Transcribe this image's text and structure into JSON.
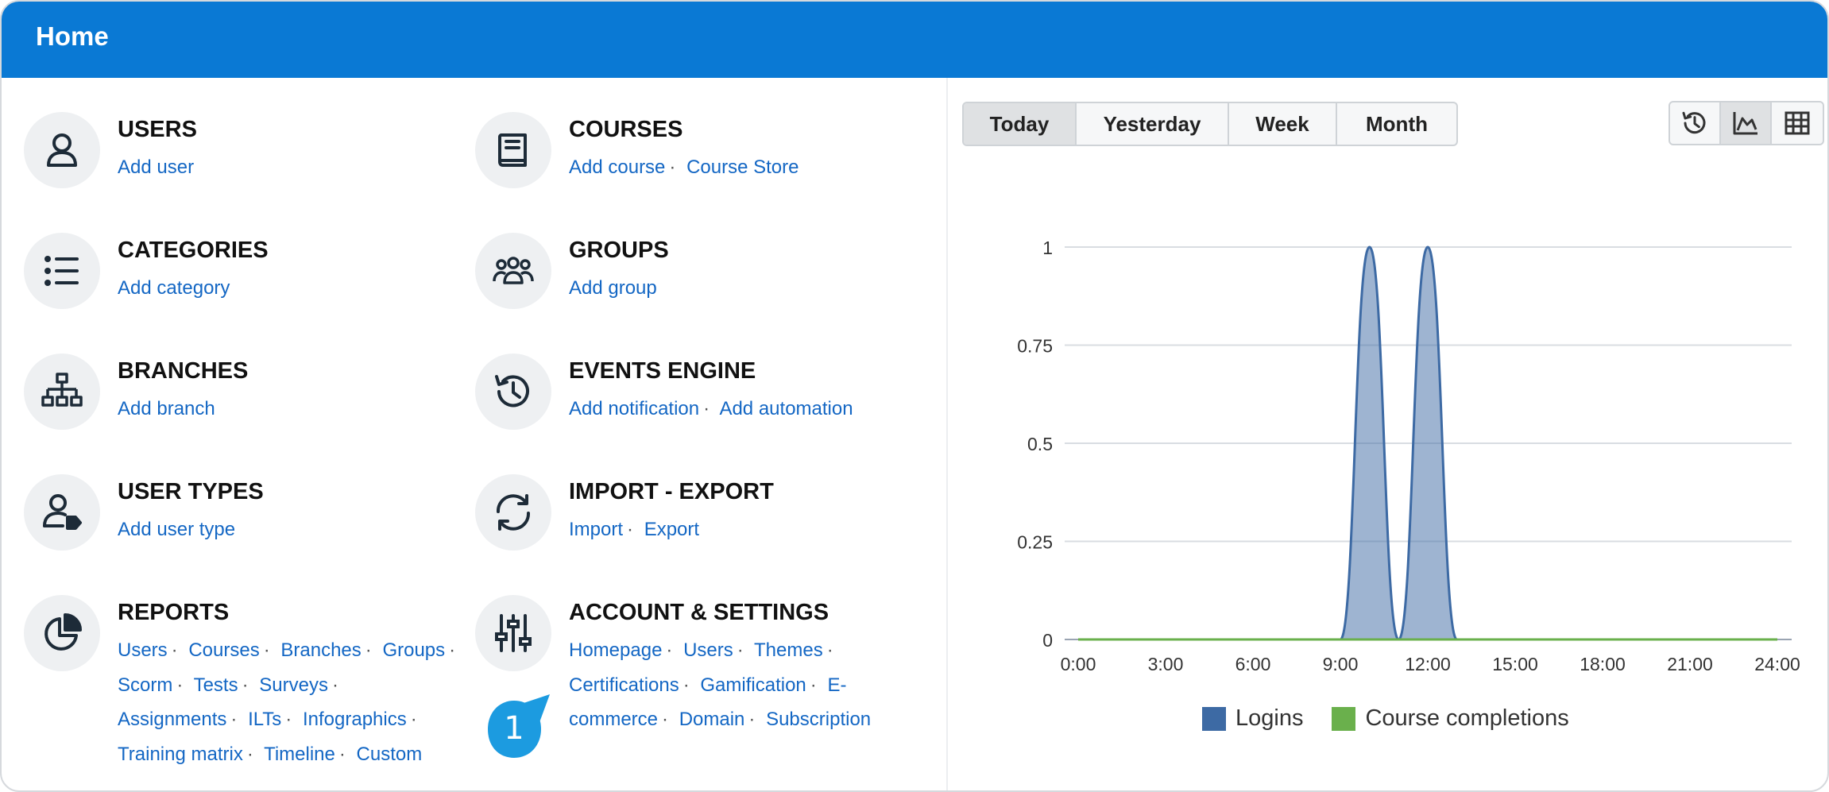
{
  "header": {
    "title": "Home"
  },
  "tiles": [
    {
      "title": "USERS",
      "icon": "user-icon",
      "links": [
        "Add user"
      ]
    },
    {
      "title": "COURSES",
      "icon": "book-icon",
      "links": [
        "Add course",
        "Course Store"
      ]
    },
    {
      "title": "CATEGORIES",
      "icon": "list-icon",
      "links": [
        "Add category"
      ]
    },
    {
      "title": "GROUPS",
      "icon": "group-icon",
      "links": [
        "Add group"
      ]
    },
    {
      "title": "BRANCHES",
      "icon": "sitemap-icon",
      "links": [
        "Add branch"
      ]
    },
    {
      "title": "EVENTS ENGINE",
      "icon": "history-icon",
      "links": [
        "Add notification",
        "Add automation"
      ]
    },
    {
      "title": "USER TYPES",
      "icon": "user-tag-icon",
      "links": [
        "Add user type"
      ]
    },
    {
      "title": "IMPORT - EXPORT",
      "icon": "sync-icon",
      "links": [
        "Import",
        "Export"
      ]
    },
    {
      "title": "REPORTS",
      "icon": "pie-chart-icon",
      "links": [
        "Users",
        "Courses",
        "Branches",
        "Groups",
        "Scorm",
        "Tests",
        "Surveys",
        "Assignments",
        "ILTs",
        "Infographics",
        "Training matrix",
        "Timeline",
        "Custom"
      ]
    },
    {
      "title": "ACCOUNT & SETTINGS",
      "icon": "sliders-icon",
      "links": [
        "Homepage",
        "Users",
        "Themes",
        "Certifications",
        "Gamification",
        "E-commerce",
        "Domain",
        "Subscription"
      ]
    }
  ],
  "callout": {
    "number": "1",
    "color": "#1c9be0"
  },
  "period_tabs": {
    "items": [
      "Today",
      "Yesterday",
      "Week",
      "Month"
    ],
    "selected": "Today"
  },
  "view_toggle": {
    "items": [
      "history-icon",
      "area-chart-icon",
      "table-icon"
    ],
    "selected": "area-chart-icon"
  },
  "chart_data": {
    "type": "area",
    "title": "",
    "xlabel": "",
    "ylabel": "",
    "x_ticks": [
      "0:00",
      "3:00",
      "6:00",
      "9:00",
      "12:00",
      "15:00",
      "18:00",
      "21:00",
      "24:00"
    ],
    "y_ticks": [
      "0",
      "0.25",
      "0.5",
      "0.75",
      "1"
    ],
    "xlim": [
      0,
      24
    ],
    "ylim": [
      0,
      1
    ],
    "grid": true,
    "legend_position": "bottom",
    "series": [
      {
        "name": "Logins",
        "color": "#3d6aa4",
        "points": [
          [
            0,
            0
          ],
          [
            9,
            0
          ],
          [
            10,
            1
          ],
          [
            11,
            0
          ],
          [
            12,
            1
          ],
          [
            13,
            0
          ],
          [
            24,
            0
          ]
        ]
      },
      {
        "name": "Course completions",
        "color": "#6ab04c",
        "points": [
          [
            0,
            0
          ],
          [
            24,
            0
          ]
        ]
      }
    ]
  },
  "colors": {
    "header": "#0a79d4",
    "link": "#1467c4",
    "logins": "#3d6aa4",
    "completions": "#6ab04c"
  }
}
